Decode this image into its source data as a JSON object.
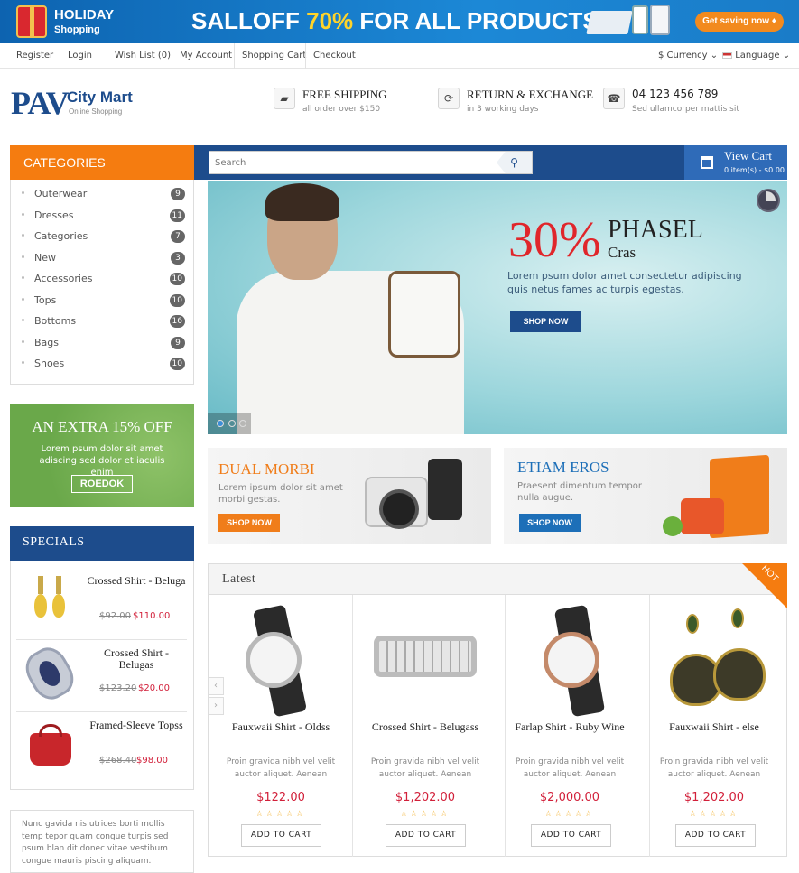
{
  "promo_banner": {
    "holiday": "HOLIDAY",
    "holiday_sub": "Shopping",
    "salloff": "SALLOFF",
    "percent": "70%",
    "rest": "FOR ALL PRODUCTS",
    "cta": "Get saving now ♦"
  },
  "top_links": {
    "register": "Register",
    "login": "Login",
    "wishlist": "Wish List (0)",
    "account": "My Account",
    "cart": "Shopping Cart",
    "checkout": "Checkout",
    "currency": "$ Currency",
    "language": "Language"
  },
  "logo": {
    "pav": "PAV",
    "city": "City Mart",
    "sub": "Online Shopping"
  },
  "header_features": [
    {
      "icon": "truck-icon",
      "title": "FREE SHIPPING",
      "sub": "all order over $150"
    },
    {
      "icon": "exchange-icon",
      "title": "RETURN & EXCHANGE",
      "sub": "in 3 working days"
    },
    {
      "icon": "phone-icon",
      "title": "04 123 456 789",
      "sub": "Sed ullamcorper mattis sit"
    }
  ],
  "categories": {
    "title": "CATEGORIES",
    "items": [
      {
        "label": "Outerwear",
        "count": "9"
      },
      {
        "label": "Dresses",
        "count": "11"
      },
      {
        "label": "Categories",
        "count": "7"
      },
      {
        "label": "New",
        "count": "3"
      },
      {
        "label": "Accessories",
        "count": "10"
      },
      {
        "label": "Tops",
        "count": "10"
      },
      {
        "label": "Bottoms",
        "count": "16"
      },
      {
        "label": "Bags",
        "count": "9"
      },
      {
        "label": "Shoes",
        "count": "10"
      }
    ]
  },
  "promo_box": {
    "title": "AN EXTRA 15% OFF",
    "text": "Lorem psum dolor sit amet adiscing sed dolor et iaculis enim",
    "button": "ROEDOK"
  },
  "specials": {
    "title": "SPECIALS",
    "items": [
      {
        "name": "Crossed Shirt - Beluga",
        "old": "$92.00",
        "new": "$110.00"
      },
      {
        "name": "Crossed Shirt - Belugas",
        "old": "$123.20",
        "new": "$20.00"
      },
      {
        "name": "Framed-Sleeve Topss",
        "old": "$268.40",
        "new": "$98.00"
      }
    ]
  },
  "about_text": "Nunc gavida nis utrices borti mollis temp tepor quam congue turpis sed psum blan dit donec vitae vestibum congue mauris piscing aliquam.",
  "search": {
    "placeholder": "Search"
  },
  "cart": {
    "title": "View Cart",
    "sub": "0 item(s) - $0.00"
  },
  "slider": {
    "percent": "30%",
    "t1": "PHASEL",
    "t2": "Cras",
    "text": "Lorem psum dolor amet consectetur adipiscing quis netus fames ac turpis egestas.",
    "button": "SHOP NOW"
  },
  "mini_banners": [
    {
      "title": "DUAL MORBI",
      "text": "Lorem ipsum dolor sit amet morbi gestas.",
      "button": "SHOP NOW",
      "color": "#f07d1a"
    },
    {
      "title": "ETIAM EROS",
      "text": "Praesent dimentum tempor nulla augue.",
      "button": "SHOP NOW",
      "color": "#1d6fb8"
    }
  ],
  "latest": {
    "title": "Latest",
    "badge": "HOT",
    "products": [
      {
        "name": "Fauxwaii Shirt - Oldss",
        "desc": "Proin gravida nibh vel velit auctor aliquet. Aenean",
        "price": "$122.00",
        "stars": "☆☆☆☆☆",
        "button": "ADD TO CART"
      },
      {
        "name": "Crossed Shirt - Belugass",
        "desc": "Proin gravida nibh vel velit auctor aliquet. Aenean",
        "price": "$1,202.00",
        "stars": "☆☆☆☆☆",
        "button": "ADD TO CART"
      },
      {
        "name": "Farlap Shirt - Ruby Wine",
        "desc": "Proin gravida nibh vel velit auctor aliquet. Aenean",
        "price": "$2,000.00",
        "stars": "☆☆☆☆☆",
        "button": "ADD TO CART"
      },
      {
        "name": "Fauxwaii Shirt - else",
        "desc": "Proin gravida nibh vel velit auctor aliquet. Aenean",
        "price": "$1,202.00",
        "stars": "☆☆☆☆☆",
        "button": "ADD TO CART"
      }
    ]
  },
  "colors": {
    "accent_orange": "#f57c10",
    "brand_blue": "#1d4c8c",
    "price_red": "#d2203a"
  }
}
